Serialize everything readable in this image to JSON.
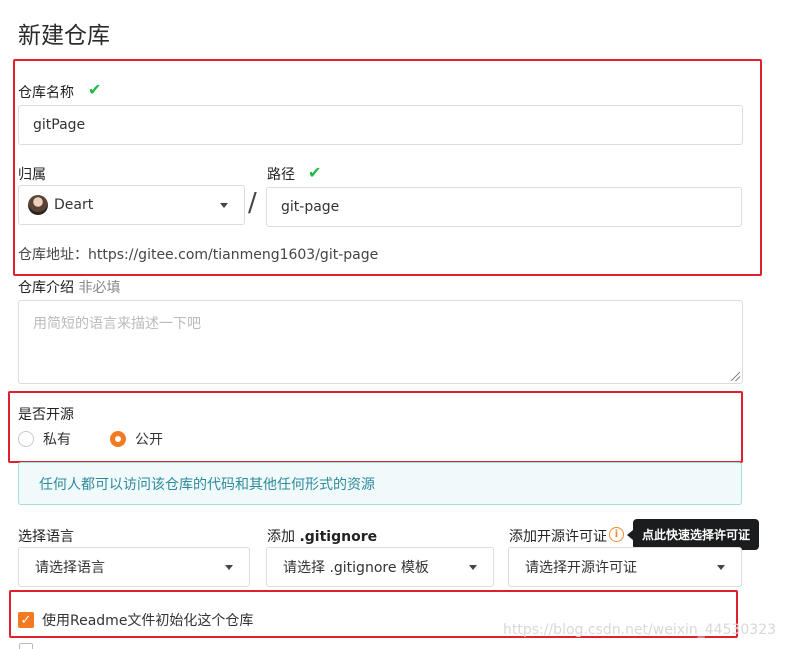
{
  "page": {
    "title": "新建仓库"
  },
  "repo_name": {
    "label": "仓库名称",
    "value": "gitPage",
    "valid_icon": "check-icon"
  },
  "owner": {
    "label": "归属",
    "value": "Deart"
  },
  "path": {
    "separator": "/",
    "label": "路径",
    "value": "git-page",
    "valid_icon": "check-icon"
  },
  "address": {
    "label": "仓库地址：",
    "url": "https://gitee.com/tianmeng1603/git-page"
  },
  "description": {
    "label": "仓库介绍",
    "optional": "非必填",
    "placeholder": "用简短的语言来描述一下吧"
  },
  "visibility": {
    "label": "是否开源",
    "options": [
      {
        "label": "私有",
        "selected": false
      },
      {
        "label": "公开",
        "selected": true
      }
    ],
    "notice": "任何人都可以访问该仓库的代码和其他任何形式的资源"
  },
  "language": {
    "label": "选择语言",
    "value": "请选择语言"
  },
  "gitignore": {
    "label_prefix": "添加 ",
    "label_bold": ".gitignore",
    "value": "请选择 .gitignore 模板"
  },
  "license": {
    "label": "添加开源许可证",
    "value": "请选择开源许可证",
    "tooltip": "点此快速选择许可证",
    "info_icon": "i"
  },
  "readme": {
    "label": "使用Readme文件初始化这个仓库",
    "checked": true
  },
  "watermark": "https://blog.csdn.net/weixin_44530323",
  "colors": {
    "accent": "#f27b21",
    "valid": "#21ba45",
    "highlight_border": "#e0202a",
    "notice_text": "#2d8a9e"
  }
}
